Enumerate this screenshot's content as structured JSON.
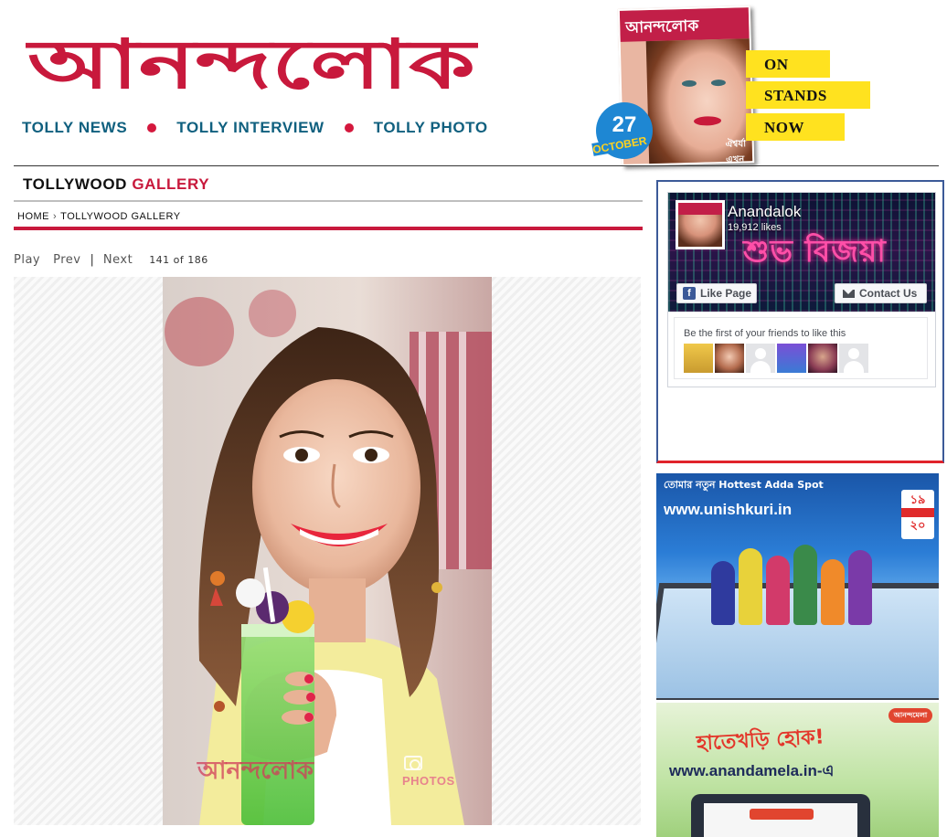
{
  "brand": {
    "logo_text": "আনন্দলোক"
  },
  "nav": {
    "items": [
      {
        "label": "TOLLY NEWS"
      },
      {
        "label": "TOLLY INTERVIEW"
      },
      {
        "label": "TOLLY PHOTO"
      }
    ]
  },
  "promo": {
    "cover_title": "আনন্দলোক",
    "cover_tag": "ঐশ্বর্যা এখন",
    "date_day": "27",
    "date_month": "OCTOBER",
    "stand_lines": [
      "ON",
      "STANDS",
      "NOW"
    ]
  },
  "section": {
    "title_main": "TOLLYWOOD",
    "title_accent": "GALLERY"
  },
  "breadcrumb": {
    "home": "HOME",
    "separator": "›",
    "current": "TOLLYWOOD GALLERY"
  },
  "pager": {
    "play": "Play",
    "prev": "Prev",
    "divider": "|",
    "next": "Next",
    "count": "141 of 186"
  },
  "photo": {
    "watermark": "আনন্দলোক",
    "watermark_sub": "PHOTOS"
  },
  "facebook": {
    "page_name": "Anandalok",
    "likes": "19,912 likes",
    "cover_text": "শুভ বিজয়া",
    "like_button": "Like Page",
    "contact_button": "Contact Us",
    "friends_text": "Be the first of your friends to like this"
  },
  "ads": {
    "unishkuri": {
      "headline": "তোমার নতুন Hottest Adda Spot",
      "url": "www.unishkuri.in",
      "badge_top": "১৯",
      "badge_bottom": "২০"
    },
    "anandamela": {
      "logo": "আনন্দমেলা",
      "headline": "হাতেখড়ি হোক!",
      "url": "www.anandamela.in-এ"
    }
  },
  "colors": {
    "brand_red": "#c8193c",
    "nav_blue": "#10607f",
    "promo_yellow": "#ffe21f",
    "facebook_blue": "#3b5998"
  }
}
